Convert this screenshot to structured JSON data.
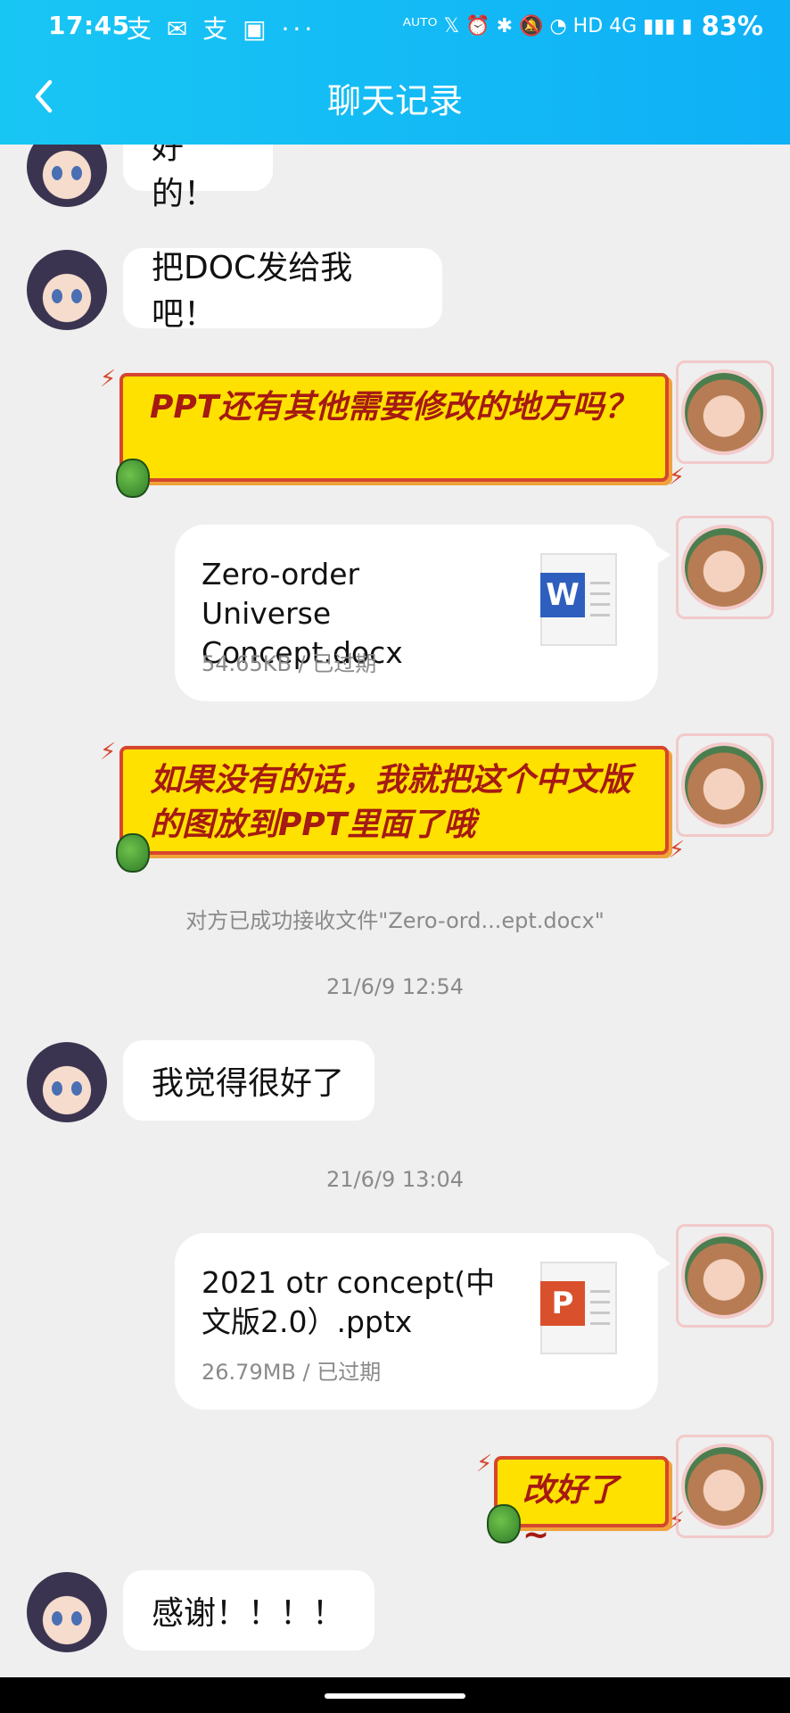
{
  "status_bar": {
    "time": "17:45",
    "left_icons": "支 ✉ 支 ▣ ···",
    "right_icons": "ᴬᵁᵀᴼ 𝕏 ⏰ ✱ 🔕 ◔ HD 4G ▮▮▮ ▮",
    "battery": "83%"
  },
  "header": {
    "title": "聊天记录",
    "back_icon": "chevron-left-icon"
  },
  "colors": {
    "header_accent": "#18c6f4",
    "yellow_bubble": "#ffe100",
    "yellow_bubble_text": "#a51a12",
    "word_blue": "#2f5fbe",
    "ppt_orange": "#d9502c"
  },
  "messages": [
    {
      "side": "left",
      "type": "text",
      "text": "好的！"
    },
    {
      "side": "left",
      "type": "text",
      "text": "把DOC发给我吧！"
    },
    {
      "side": "right",
      "type": "sticker-text",
      "text": "PPT还有其他需要修改的地方吗？"
    },
    {
      "side": "right",
      "type": "file",
      "file_name": "Zero-order Universe Concept.docx",
      "meta": "54.65KB / 已过期",
      "icon": "word-icon",
      "badge": "W"
    },
    {
      "side": "right",
      "type": "sticker-text",
      "text": "如果没有的话，我就把这个中文版的图放到PPT里面了哦"
    },
    {
      "side": "system",
      "type": "notice",
      "text": "对方已成功接收文件\"Zero-ord...ept.docx\""
    },
    {
      "side": "system",
      "type": "timestamp",
      "text": "21/6/9 12:54"
    },
    {
      "side": "left",
      "type": "text",
      "text": "我觉得很好了"
    },
    {
      "side": "system",
      "type": "timestamp",
      "text": "21/6/9 13:04"
    },
    {
      "side": "right",
      "type": "file",
      "file_name": "2021 otr concept(中文版2.0）.pptx",
      "meta": "26.79MB / 已过期",
      "icon": "powerpoint-icon",
      "badge": "P"
    },
    {
      "side": "right",
      "type": "sticker-text",
      "text": "改好了~"
    },
    {
      "side": "left",
      "type": "text",
      "text": "感谢！！！！"
    }
  ]
}
